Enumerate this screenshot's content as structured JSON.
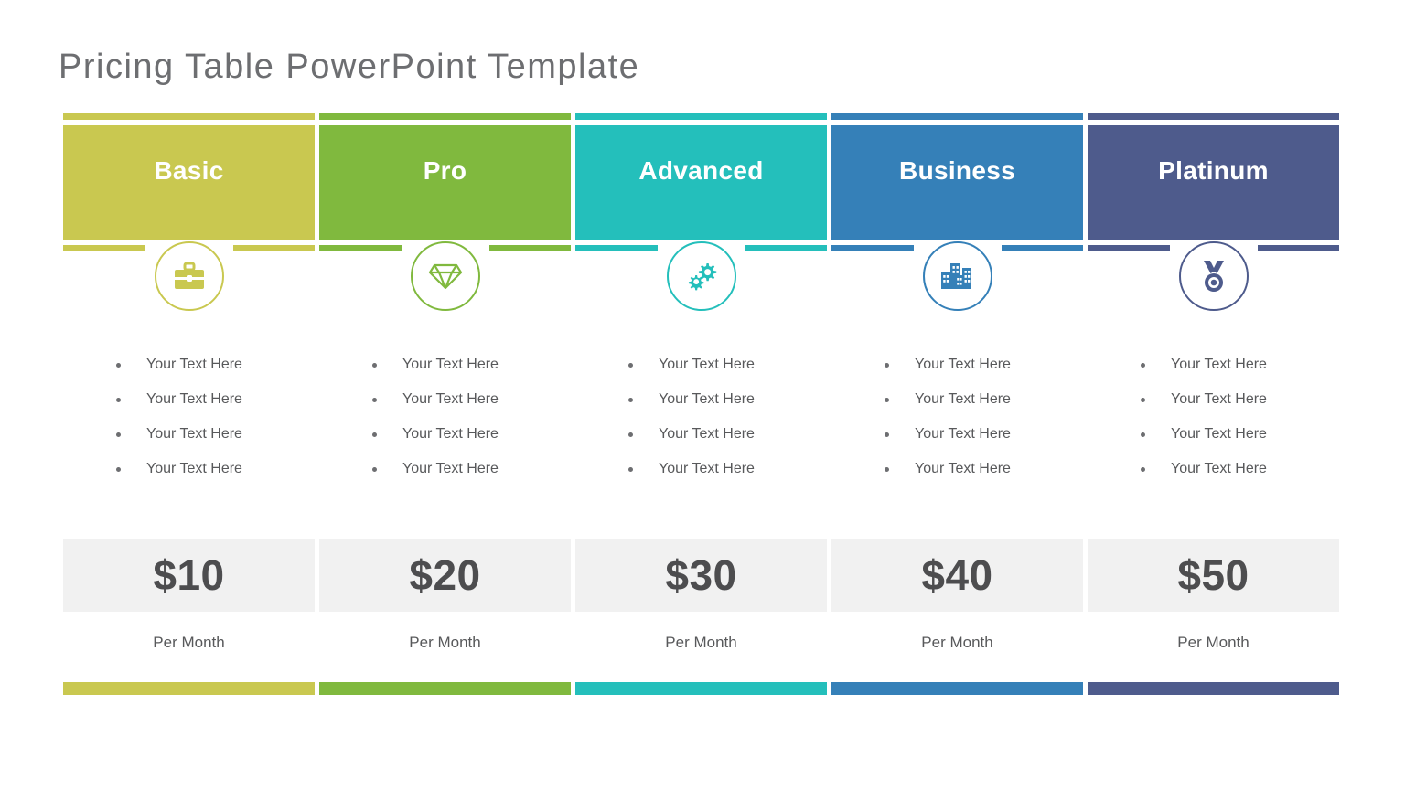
{
  "slide": {
    "title": "Pricing Table PowerPoint Template",
    "background_color": "#ffffff"
  },
  "shared": {
    "price_box_background": "#f1f1f1",
    "price_text_color": "#4d4d4f",
    "body_text_color": "#58595b",
    "title_color": "#6d6e71"
  },
  "plans": [
    {
      "name": "Basic",
      "color": "#c9c850",
      "icon": "briefcase-icon",
      "price": "$10",
      "period": "Per Month",
      "features": [
        "Your Text Here",
        "Your Text Here",
        "Your Text Here",
        "Your Text Here"
      ]
    },
    {
      "name": "Pro",
      "color": "#80b93e",
      "icon": "diamond-icon",
      "price": "$20",
      "period": "Per Month",
      "features": [
        "Your Text Here",
        "Your Text Here",
        "Your Text Here",
        "Your Text Here"
      ]
    },
    {
      "name": "Advanced",
      "color": "#24bfbb",
      "icon": "gears-icon",
      "price": "$30",
      "period": "Per Month",
      "features": [
        "Your Text Here",
        "Your Text Here",
        "Your Text Here",
        "Your Text Here"
      ]
    },
    {
      "name": "Business",
      "color": "#3580b8",
      "icon": "buildings-icon",
      "price": "$40",
      "period": "Per Month",
      "features": [
        "Your Text Here",
        "Your Text Here",
        "Your Text Here",
        "Your Text Here"
      ]
    },
    {
      "name": "Platinum",
      "color": "#4e5b8c",
      "icon": "medal-icon",
      "price": "$50",
      "period": "Per Month",
      "features": [
        "Your Text Here",
        "Your Text Here",
        "Your Text Here",
        "Your Text Here"
      ]
    }
  ]
}
